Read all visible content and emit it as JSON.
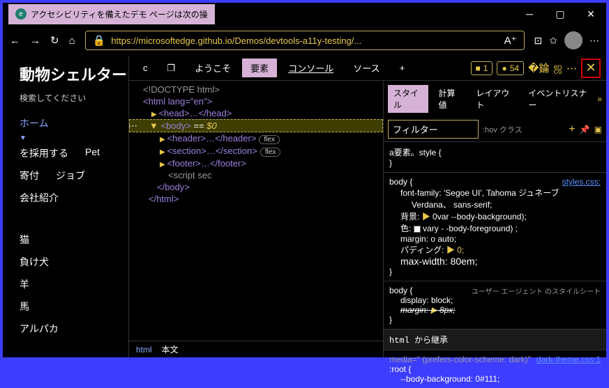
{
  "titlebar": {
    "tabTitle": "アクセシビリティを備えたデモ ページは次の操"
  },
  "toolbar": {
    "url": "https://microsoftedge.github.io/Demos/devtools-a11y-testing/..."
  },
  "page": {
    "title": "動物シェルター",
    "searchLabel": "検索してください",
    "nav": {
      "home": "ホーム",
      "adopt": "を採用する",
      "pet": "Pet",
      "donate": "寄付",
      "jobs": "ジョブ",
      "about": "会社紹介"
    },
    "animals": {
      "cat": "猫",
      "loser": "負け犬",
      "sheep": "羊",
      "horse": "馬",
      "alpaca": "アルパカ"
    }
  },
  "devtools": {
    "tabs": {
      "welcome": "ようこそ",
      "elements": "要素",
      "console": "コンソール",
      "sources": "ソース"
    },
    "issues": "1",
    "messages": "54",
    "dom": {
      "doctype": "<!DOCTYPE html>",
      "html_open": "<html lang=\"en\">",
      "head": "<head>…</head>",
      "body_sel": "<body> == $0",
      "header": "<header>…</header>",
      "section": "<section>…</section>",
      "footer": "<footer>…</footer>",
      "script": "<script sec",
      "body_close": "</body>",
      "html_close": "</html>",
      "flex": "flex"
    },
    "breadcrumb": {
      "html": "html",
      "body": "本文"
    },
    "styles": {
      "tabs": {
        "styles": "スタイル",
        "computed": "計算値",
        "layout": "レイアウト",
        "listeners": "イベントリスナー"
      },
      "filter": "フィルター",
      "hov": ":hov クラス",
      "el_style": "a要素。style {",
      "brace": "}",
      "r1": {
        "sel": "body {",
        "link": "styles.css:",
        "ff": "font-family: 'Segoe            UI',    Tahoma   ジュネーブ",
        "ff2": "Verdana、 sans-serif;",
        "bg": "背景:",
        "bgv": "0var --body-background);",
        "color": "色:",
        "colorv": "vary - -body-foreground) ;",
        "margin": "margin: o auto;",
        "padding": "パディング:",
        "pv": "0;",
        "mw": "max-width: 80em;"
      },
      "r2": {
        "sel": "body {",
        "ua": "ユーザー エージェント のスタイルシート",
        "d": "display: block;",
        "m": "margin:",
        "mv": "8px;"
      },
      "r3": {
        "header": "html から継承",
        "media": "media=\" (prefers-color-scheme: dark)\"",
        "root": ":root {",
        "link": "dark-theme.css:1",
        "bb": "--body-background: 0#111;"
      }
    }
  }
}
